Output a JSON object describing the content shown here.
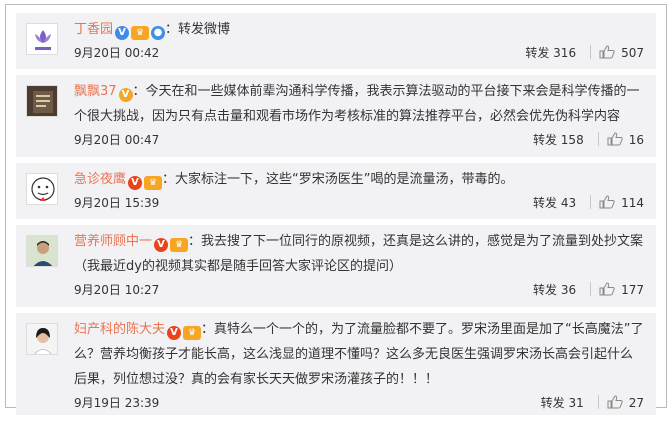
{
  "comments": [
    {
      "avatar": "lily-logo",
      "name": "丁香园",
      "badges": [
        "v-blue",
        "vip",
        "emoji"
      ],
      "text": "：转发微博",
      "time": "9月20日 00:42",
      "forward": "转发 316",
      "likes": "507"
    },
    {
      "avatar": "book-photo",
      "name": "飘飘37",
      "badges": [
        "v-gold"
      ],
      "text": "：今天在和一些媒体前辈沟通科学传播，我表示算法驱动的平台接下来会是科学传播的一个很大挑战，因为只有点击量和观看市场作为考核标准的算法推荐平台，必然会优先伪科学内容",
      "time": "9月20日 00:47",
      "forward": "转发 158",
      "likes": "16"
    },
    {
      "avatar": "cartoon-doctor",
      "name": "急诊夜鹰",
      "badges": [
        "v-red",
        "vip"
      ],
      "text": "：大家标注一下，这些“罗宋汤医生”喝的是流量汤，带毒的。",
      "time": "9月20日 15:39",
      "forward": "转发 43",
      "likes": "114"
    },
    {
      "avatar": "portrait-man",
      "name": "营养师顾中一",
      "badges": [
        "v-red",
        "vip"
      ],
      "text": "：我去搜了下一位同行的原视频，还真是这么讲的，感觉是为了流量到处抄文案（我最近dy的视频其实都是随手回答大家评论区的提问）",
      "time": "9月20日 10:27",
      "forward": "转发 36",
      "likes": "177"
    },
    {
      "avatar": "portrait-woman",
      "name": "妇产科的陈大夫",
      "badges": [
        "v-red",
        "vip"
      ],
      "text": "：真特么一个一个的，为了流量脸都不要了。罗宋汤里面是加了“长高魔法”了么？营养均衡孩子才能长高，这么浅显的道理不懂吗？这么多无良医生强调罗宋汤长高会引起什么后果，列位想过没？真的会有家长天天做罗宋汤灌孩子的！！！",
      "time": "9月19日 23:39",
      "forward": "转发 31",
      "likes": "27"
    }
  ],
  "colors": {
    "author": "#eb7350",
    "item_bg": "#f2f2f5",
    "v_red": "#e9431c",
    "v_gold": "#f6a623",
    "v_blue": "#3f8be6"
  }
}
